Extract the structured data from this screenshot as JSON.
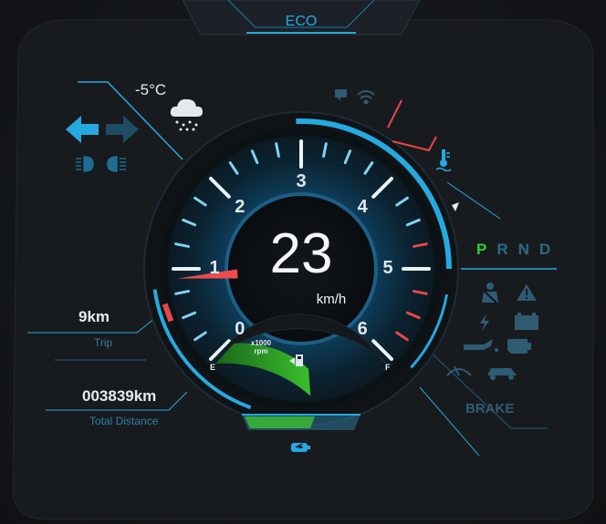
{
  "header": {
    "mode": "ECO"
  },
  "weather": {
    "temperature": "-5°C",
    "icon": "snow-cloud-icon"
  },
  "speed": {
    "value": "23",
    "unit": "km/h"
  },
  "rpm": {
    "ticks": [
      "0",
      "1",
      "2",
      "3",
      "4",
      "5",
      "6"
    ],
    "unit_line1": "x1000",
    "unit_line2": "rpm",
    "current_value": 0.9
  },
  "fuel": {
    "empty_label": "E",
    "full_label": "F",
    "level": 0.55,
    "icon": "fuel-pump-icon"
  },
  "trip": {
    "value": "9km",
    "label": "Trip"
  },
  "total": {
    "value": "003839km",
    "label": "Total Distance"
  },
  "gears": {
    "items": [
      "P",
      "R",
      "N",
      "D"
    ],
    "active": "P"
  },
  "warnings": {
    "brake_label": "BRAKE"
  },
  "colors": {
    "accent": "#26a9e0",
    "active_gear": "#2fd12f",
    "redline": "#e8464a",
    "fuel_green": "#3ec62a"
  }
}
